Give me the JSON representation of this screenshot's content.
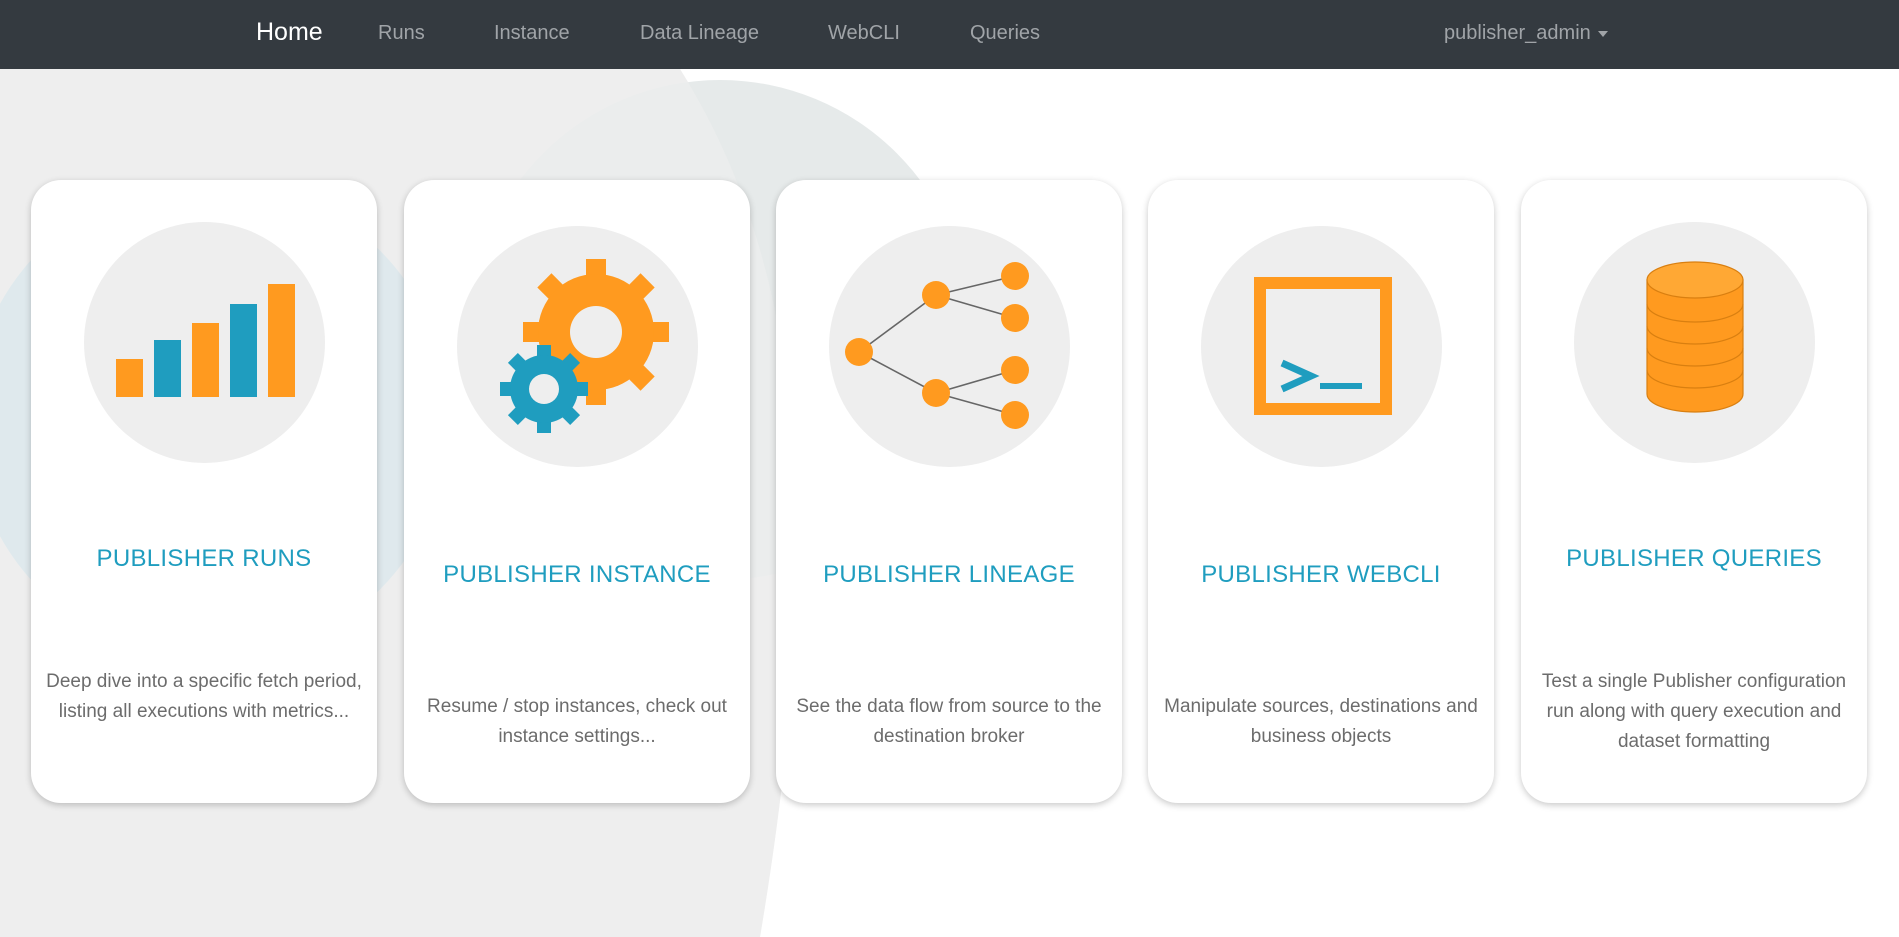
{
  "navbar": {
    "brand": "Home",
    "links": [
      "Runs",
      "Instance",
      "Data Lineage",
      "WebCLI",
      "Queries"
    ],
    "user": "publisher_admin"
  },
  "colors": {
    "navbar_bg": "#343a40",
    "accent_orange": "#ff9a1f",
    "accent_blue": "#1f9dbf",
    "card_title": "#1f9dbf",
    "icon_circle": "#eeeeee"
  },
  "cards": [
    {
      "icon": "bar-chart-icon",
      "title": "PUBLISHER RUNS",
      "description": "Deep dive into a specific fetch period, listing all executions with metrics..."
    },
    {
      "icon": "gears-icon",
      "title": "PUBLISHER INSTANCE",
      "description": "Resume / stop instances, check out instance settings..."
    },
    {
      "icon": "lineage-tree-icon",
      "title": "PUBLISHER LINEAGE",
      "description": "See the data flow from source to the destination broker"
    },
    {
      "icon": "terminal-icon",
      "title": "PUBLISHER WEBCLI",
      "description": "Manipulate sources, destinations and business objects"
    },
    {
      "icon": "database-icon",
      "title": "PUBLISHER QUERIES",
      "description": "Test a single Publisher configuration run along with query execution and dataset formatting"
    }
  ]
}
